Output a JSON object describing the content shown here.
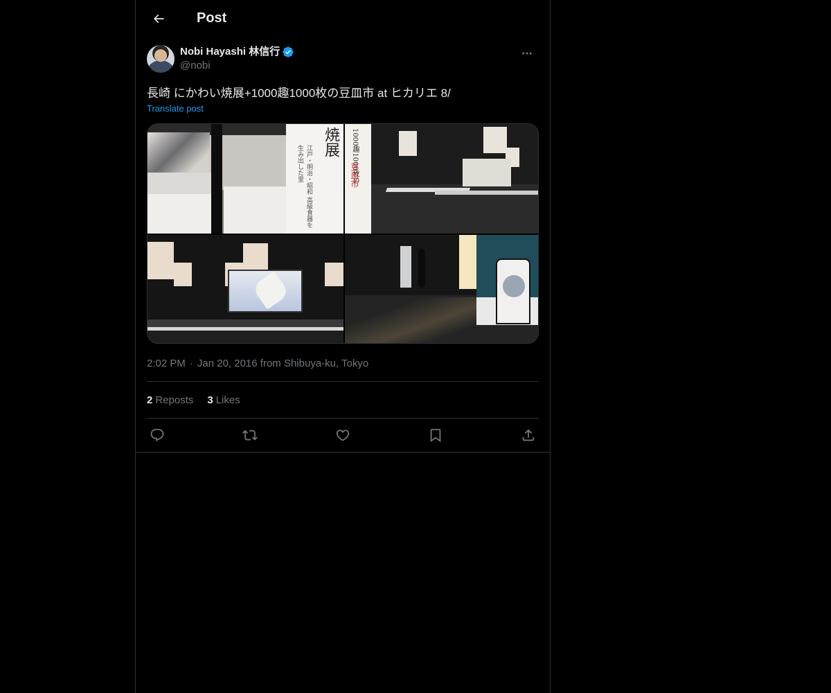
{
  "header": {
    "title": "Post"
  },
  "post": {
    "author": {
      "display_name": "Nobi Hayashi 林信行",
      "handle": "@nobi",
      "verified": true
    },
    "text": "長崎 にかわい焼展+1000趣1000枚の豆皿市 at ヒカリエ 8/",
    "translate_label": "Translate post",
    "media": {
      "photo1_banner_title": "長崎 みかわち焼展",
      "photo1_banner_sub": "江戸・明治・昭和 高級食器を生み出した里",
      "photo2_banner_text": "1000趣1000枚の",
      "photo2_banner_red": "豆皿市"
    },
    "timestamp": {
      "time": "2:02 PM",
      "date": "Jan 20, 2016 from Shibuya-ku, Tokyo"
    },
    "stats": {
      "reposts_count": "2",
      "reposts_label": "Reposts",
      "likes_count": "3",
      "likes_label": "Likes"
    }
  },
  "colors": {
    "background": "#000000",
    "text": "#e7e9ea",
    "secondary": "#71767b",
    "accent": "#1d9bf0",
    "border": "#2f3336"
  },
  "icons": {
    "back": "arrow-left-icon",
    "verified": "verified-badge-icon",
    "more": "more-horizontal-icon",
    "reply": "reply-icon",
    "repost": "repost-icon",
    "like": "heart-icon",
    "bookmark": "bookmark-icon",
    "share": "share-icon"
  }
}
